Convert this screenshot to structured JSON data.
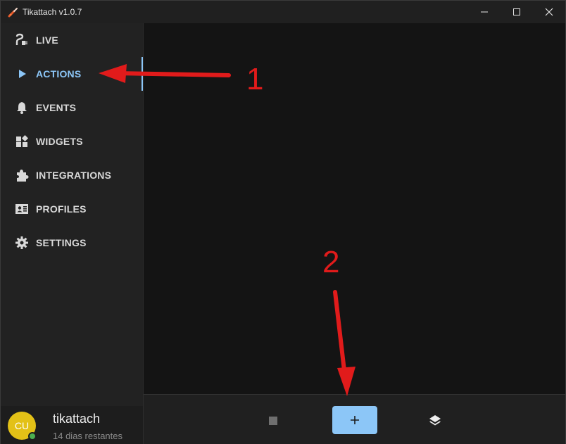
{
  "window": {
    "title": "Tikattach v1.0.7",
    "controls": [
      "minimize-icon",
      "maximize-icon",
      "close-icon"
    ]
  },
  "sidebar": {
    "items": [
      {
        "label": "LIVE",
        "icon": "plug-icon",
        "active": false
      },
      {
        "label": "ACTIONS",
        "icon": "play-icon",
        "active": true
      },
      {
        "label": "EVENTS",
        "icon": "bell-icon",
        "active": false
      },
      {
        "label": "WIDGETS",
        "icon": "widgets-icon",
        "active": false
      },
      {
        "label": "INTEGRATIONS",
        "icon": "puzzle-icon",
        "active": false
      },
      {
        "label": "PROFILES",
        "icon": "profile-card-icon",
        "active": false
      },
      {
        "label": "SETTINGS",
        "icon": "gear-icon",
        "active": false
      }
    ]
  },
  "user": {
    "initials": "CU",
    "name": "tikattach",
    "subtitle": "14 dias restantes",
    "status": "online"
  },
  "toolbar": {
    "stop_icon": "stop-icon",
    "add_icon": "plus-icon",
    "layers_icon": "layers-icon"
  },
  "annotations": {
    "label_1": "1",
    "label_2": "2"
  },
  "colors": {
    "accent": "#8cc6f7",
    "annotation": "#e11b1b",
    "avatar": "#e3c117",
    "online": "#4caf50"
  }
}
